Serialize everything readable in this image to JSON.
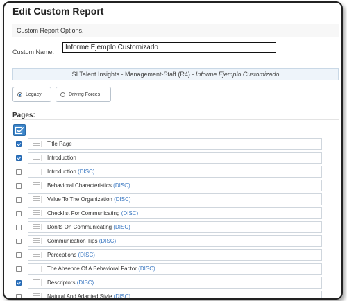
{
  "window": {
    "title": "Edit Custom Report"
  },
  "options": {
    "header": "Custom Report Options."
  },
  "custom_name": {
    "label": "Custom Name:",
    "value": "Informe Ejemplo Customizado"
  },
  "report": {
    "base": "SI Talent Insights - Management-Staff (R4) - ",
    "name": "Informe Ejemplo Customizado"
  },
  "style_options": {
    "legacy": {
      "label": "Legacy",
      "selected": true
    },
    "driving_forces": {
      "label": "Driving Forces",
      "selected": false
    }
  },
  "pages": {
    "label": "Pages:",
    "items": [
      {
        "label": "Title Page",
        "suffix": "",
        "checked": true
      },
      {
        "label": "Introduction",
        "suffix": "",
        "checked": true
      },
      {
        "label": "Introduction",
        "suffix": "(DISC)",
        "checked": false
      },
      {
        "label": "Behavioral Characteristics",
        "suffix": "(DISC)",
        "checked": false
      },
      {
        "label": "Value To The Organization",
        "suffix": "(DISC)",
        "checked": false
      },
      {
        "label": "Checklist For Communicating",
        "suffix": "(DISC)",
        "checked": false
      },
      {
        "label": "Don'ts On Communicating",
        "suffix": "(DISC)",
        "checked": false
      },
      {
        "label": "Communication Tips",
        "suffix": "(DISC)",
        "checked": false
      },
      {
        "label": "Perceptions",
        "suffix": "(DISC)",
        "checked": false
      },
      {
        "label": "The Absence Of A Behavioral Factor",
        "suffix": "(DISC)",
        "checked": false
      },
      {
        "label": "Descriptors",
        "suffix": "(DISC)",
        "checked": true
      },
      {
        "label": "Natural And Adapted Style",
        "suffix": "(DISC)",
        "checked": false
      }
    ]
  }
}
